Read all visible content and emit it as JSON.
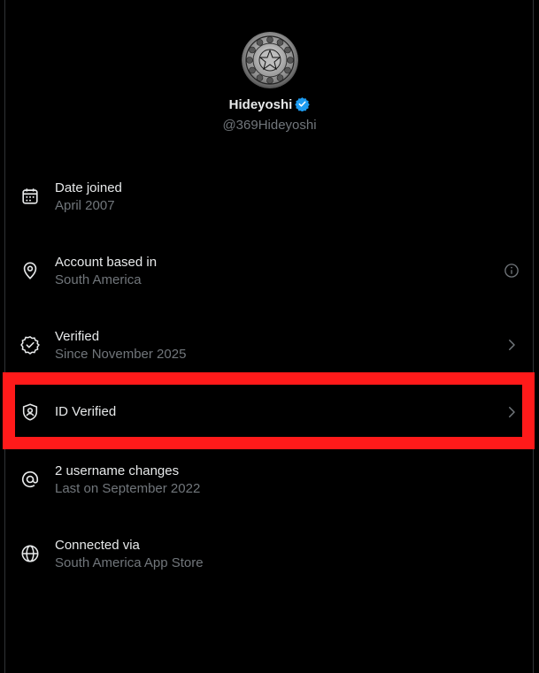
{
  "profile": {
    "name": "Hideyoshi",
    "handle": "@369Hideyoshi",
    "verified_badge_color": "#1d9bf0"
  },
  "rows": [
    {
      "title": "Date joined",
      "subtitle": "April 2007",
      "icon": "calendar-icon",
      "trail": "none"
    },
    {
      "title": "Account based in",
      "subtitle": "South America",
      "icon": "location-pin-icon",
      "trail": "info-icon"
    },
    {
      "title": "Verified",
      "subtitle": "Since November 2025",
      "icon": "verified-check-icon",
      "trail": "chevron-right-icon"
    },
    {
      "title": "ID Verified",
      "subtitle": "",
      "icon": "id-shield-icon",
      "trail": "chevron-right-icon"
    },
    {
      "title": "2 username changes",
      "subtitle": "Last on September 2022",
      "icon": "at-sign-icon",
      "trail": "none"
    },
    {
      "title": "Connected via",
      "subtitle": "South America App Store",
      "icon": "globe-icon",
      "trail": "none"
    }
  ],
  "colors": {
    "background": "#000000",
    "primary_text": "#e7e9ea",
    "secondary_text": "#71767b",
    "highlight": "#ff1a1a"
  }
}
